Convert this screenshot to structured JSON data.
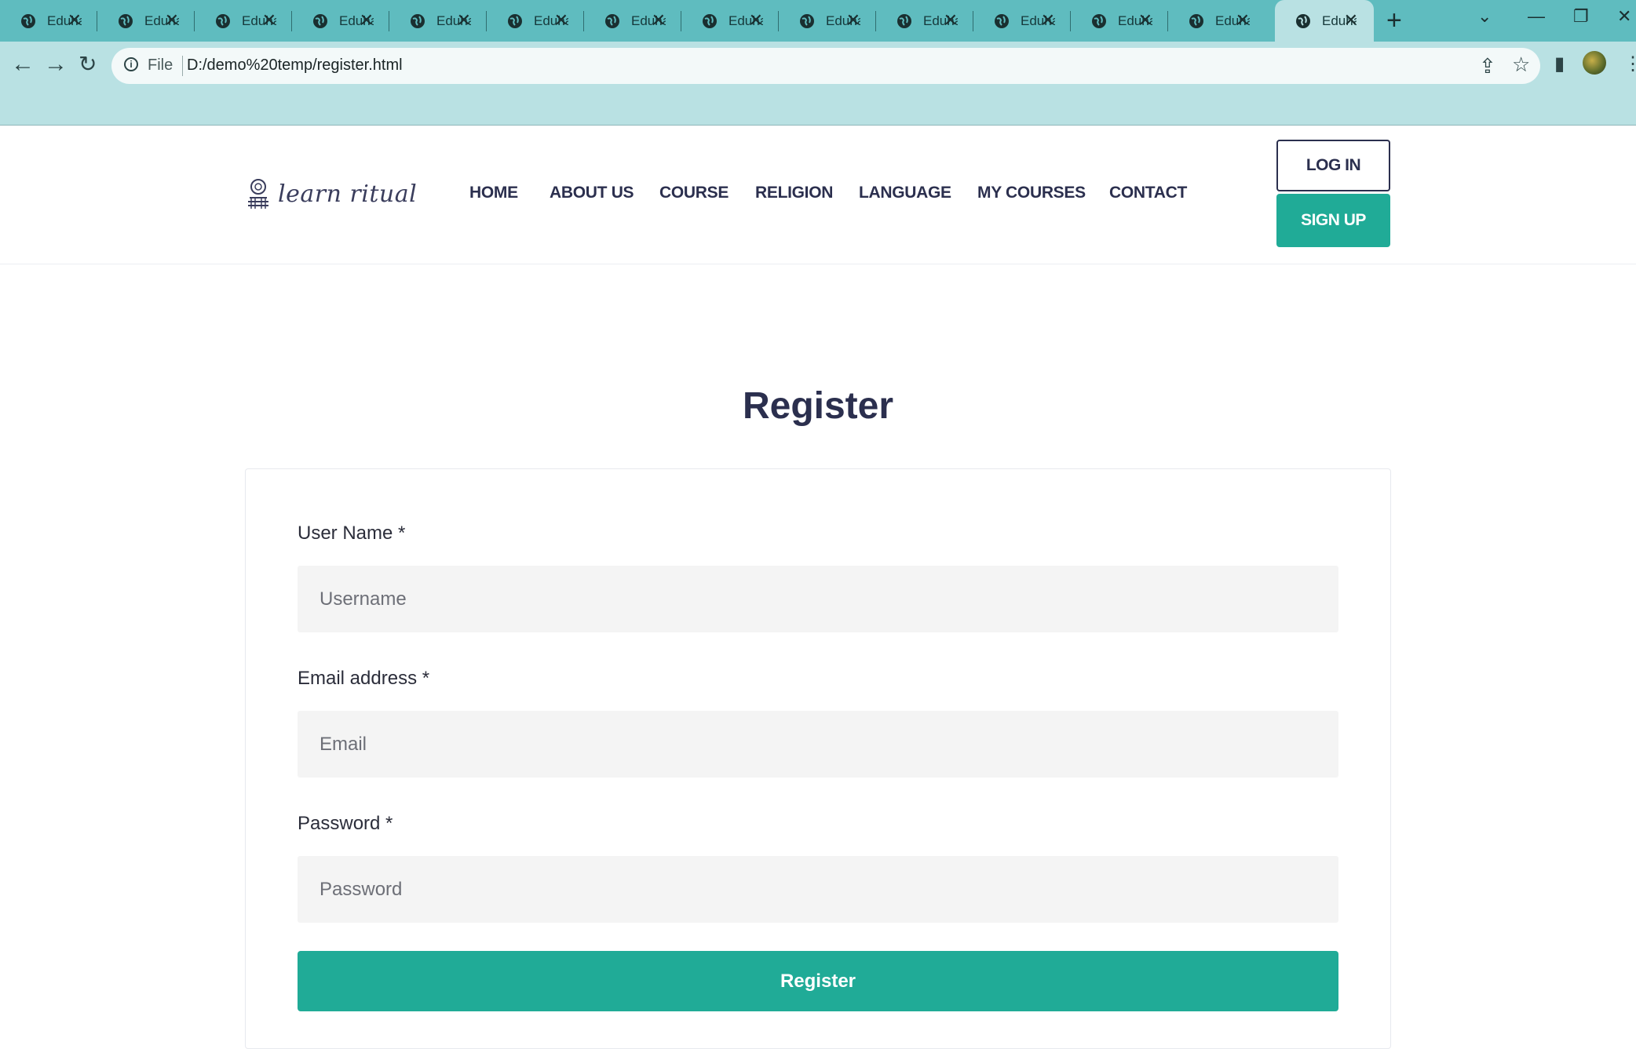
{
  "browser": {
    "tabs": [
      {
        "title": "Eduha"
      },
      {
        "title": "Eduha"
      },
      {
        "title": "Eduha"
      },
      {
        "title": "Eduha"
      },
      {
        "title": "Eduha"
      },
      {
        "title": "Eduha"
      },
      {
        "title": "Eduha"
      },
      {
        "title": "Eduha"
      },
      {
        "title": "Eduha"
      },
      {
        "title": "Eduha"
      },
      {
        "title": "Eduha"
      },
      {
        "title": "Eduha"
      },
      {
        "title": "Eduha"
      },
      {
        "title": "Eduha",
        "active": true
      }
    ],
    "new_tab_label": "+",
    "address": {
      "scheme_label": "File",
      "url": "D:/demo%20temp/register.html"
    },
    "icons": {
      "back": "arrow-left-icon",
      "forward": "arrow-right-icon",
      "reload": "reload-icon",
      "share": "share-icon",
      "bookmark": "star-icon",
      "sidepanel": "side-panel-icon",
      "menu": "kebab-menu-icon"
    }
  },
  "site": {
    "logo_text": "learn ritual",
    "nav": [
      "HOME",
      "ABOUT US",
      "COURSE",
      "RELIGION",
      "LANGUAGE",
      "MY COURSES",
      "CONTACT"
    ],
    "login_label": "LOG IN",
    "signup_label": "SIGN UP",
    "accent_color": "#20ab97",
    "text_color": "#2b2f4e"
  },
  "register": {
    "title": "Register",
    "fields": [
      {
        "label": "User Name *",
        "placeholder": "Username",
        "value": ""
      },
      {
        "label": "Email address *",
        "placeholder": "Email",
        "value": ""
      },
      {
        "label": "Password *",
        "placeholder": "Password",
        "value": ""
      }
    ],
    "submit_label": "Register"
  }
}
